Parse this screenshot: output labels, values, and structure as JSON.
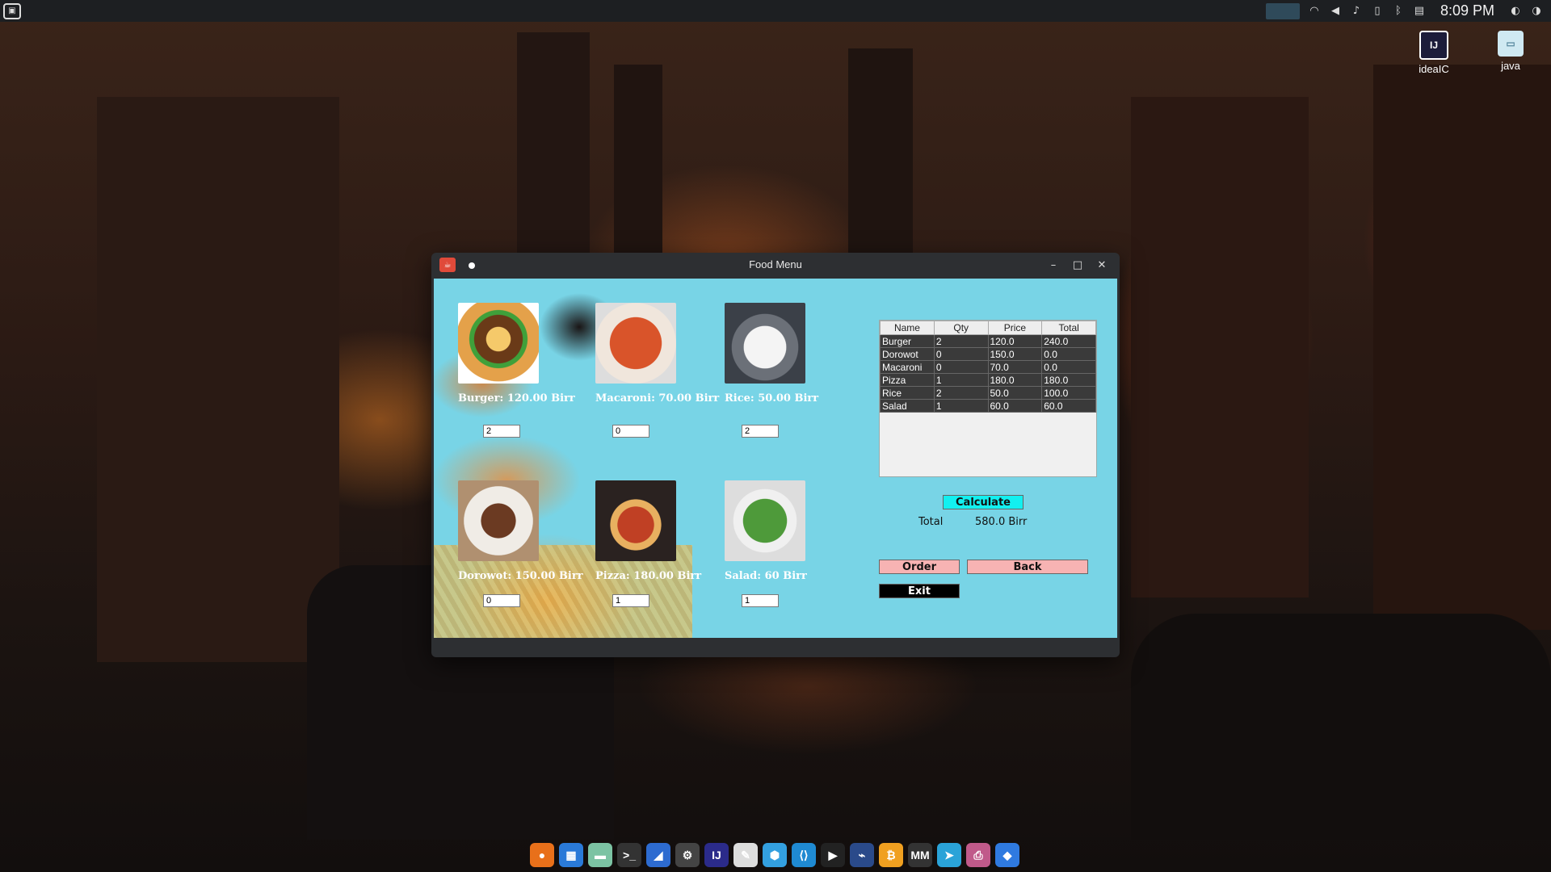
{
  "desktop": {
    "clock": "8:09 PM",
    "icons": [
      {
        "label": "ideaIC",
        "glyph": "IJ"
      },
      {
        "label": "java",
        "glyph": "▭"
      }
    ],
    "wallpaper_colors": {
      "sky": "#3a2419",
      "glow": "#ff9a3c"
    }
  },
  "window": {
    "title": "Food Menu",
    "controls": {
      "minimize": "–",
      "maximize": "□",
      "close": "✕"
    }
  },
  "menu_items": [
    {
      "label": "Burger: 120.00 Birr",
      "qty": "2",
      "img_color": "#c7742e",
      "icon": "burger-image"
    },
    {
      "label": "Macaroni: 70.00 Birr",
      "qty": "0",
      "img_color": "#d9542a",
      "icon": "macaroni-image"
    },
    {
      "label": "Rice: 50.00 Birr",
      "qty": "2",
      "img_color": "#eeeeee",
      "icon": "rice-image"
    },
    {
      "label": "Dorowot: 150.00 Birr",
      "qty": "0",
      "img_color": "#6b3a22",
      "icon": "dorowot-image"
    },
    {
      "label": "Pizza: 180.00 Birr",
      "qty": "1",
      "img_color": "#c04024",
      "icon": "pizza-image"
    },
    {
      "label": "Salad: 60 Birr",
      "qty": "1",
      "img_color": "#4e9a3a",
      "icon": "salad-image"
    }
  ],
  "order_table": {
    "headers": [
      "Name",
      "Qty",
      "Price",
      "Total"
    ],
    "rows": [
      [
        "Burger",
        "2",
        "120.0",
        "240.0"
      ],
      [
        "Dorowot",
        "0",
        "150.0",
        "0.0"
      ],
      [
        "Macaroni",
        "0",
        "70.0",
        "0.0"
      ],
      [
        "Pizza",
        "1",
        "180.0",
        "180.0"
      ],
      [
        "Rice",
        "2",
        "50.0",
        "100.0"
      ],
      [
        "Salad",
        "1",
        "60.0",
        "60.0"
      ]
    ]
  },
  "actions": {
    "calculate": "Calculate",
    "total_label": "Total",
    "total_value": "580.0 Birr",
    "order": "Order",
    "back": "Back",
    "exit": "Exit"
  },
  "dock": [
    {
      "name": "firefox-icon",
      "glyph": "●",
      "color": "#e8701a"
    },
    {
      "name": "windows-icon",
      "glyph": "▦",
      "color": "#2a7ad8"
    },
    {
      "name": "files-icon",
      "glyph": "▬",
      "color": "#7cc3a3"
    },
    {
      "name": "terminal-icon",
      "glyph": ">_",
      "color": "#333333"
    },
    {
      "name": "app-blue-icon",
      "glyph": "◢",
      "color": "#2d6bd0"
    },
    {
      "name": "settings-icon",
      "glyph": "⚙",
      "color": "#444444"
    },
    {
      "name": "intellij-icon",
      "glyph": "IJ",
      "color": "#2b2b8a"
    },
    {
      "name": "notes-icon",
      "glyph": "✎",
      "color": "#dddddd"
    },
    {
      "name": "cube-icon",
      "glyph": "⬢",
      "color": "#33a0e0"
    },
    {
      "name": "vscode-icon",
      "glyph": "⟨⟩",
      "color": "#1f8ad2"
    },
    {
      "name": "play-icon",
      "glyph": "▶",
      "color": "#222222"
    },
    {
      "name": "network-icon",
      "glyph": "⌁",
      "color": "#2a4a8a"
    },
    {
      "name": "bitcoin-icon",
      "glyph": "₿",
      "color": "#f0a020"
    },
    {
      "name": "mm-icon",
      "glyph": "MM",
      "color": "#333333"
    },
    {
      "name": "telegram-icon",
      "glyph": "➤",
      "color": "#2aa3d8"
    },
    {
      "name": "printer-icon",
      "glyph": "⎙",
      "color": "#c05a8a"
    },
    {
      "name": "diamond-icon",
      "glyph": "◆",
      "color": "#2f7ae0"
    }
  ]
}
